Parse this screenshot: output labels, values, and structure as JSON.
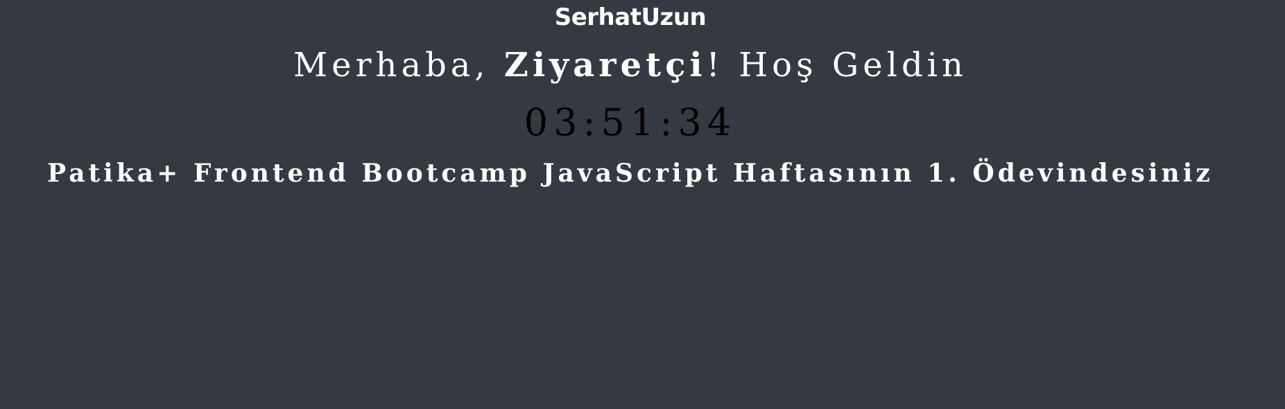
{
  "header": {
    "author": "SerhatUzun"
  },
  "greeting": {
    "prefix": "Merhaba, ",
    "name": "Ziyaretçi",
    "suffix": "! Hoş Geldin"
  },
  "clock": {
    "time": "03:51:34"
  },
  "course": {
    "text": "Patika+ Frontend Bootcamp JavaScript Haftasının 1. Ödevindesiniz"
  },
  "colors": {
    "background": "#353a42",
    "text": "#ffffff",
    "clock": "#000000"
  }
}
